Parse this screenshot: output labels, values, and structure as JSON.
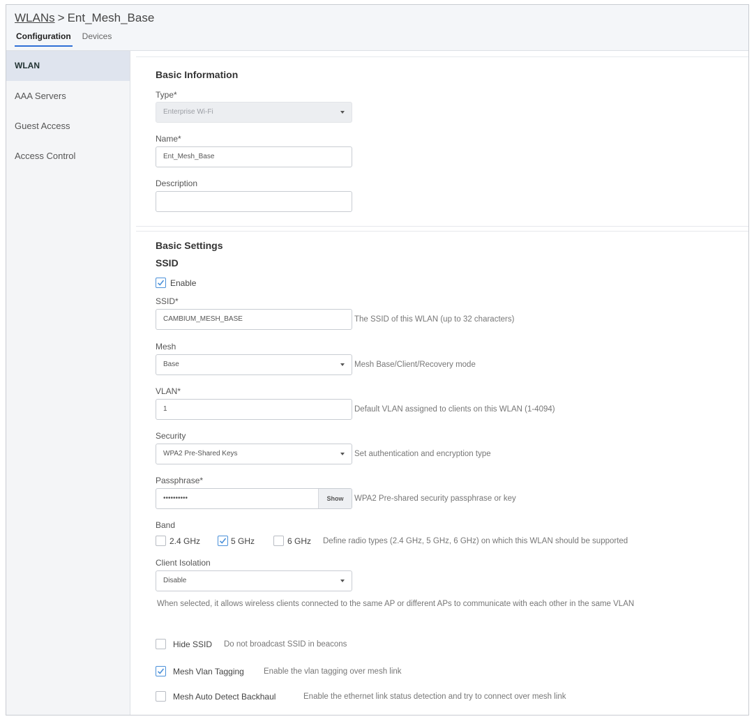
{
  "header": {
    "breadcrumb_root": "WLANs",
    "breadcrumb_sep": ">",
    "breadcrumb_current": "Ent_Mesh_Base",
    "tabs": [
      {
        "label": "Configuration",
        "active": true
      },
      {
        "label": "Devices",
        "active": false
      }
    ]
  },
  "sidebar": {
    "items": [
      {
        "label": "WLAN",
        "active": true
      },
      {
        "label": "AAA Servers",
        "active": false
      },
      {
        "label": "Guest Access",
        "active": false
      },
      {
        "label": "Access Control",
        "active": false
      }
    ]
  },
  "basic_info": {
    "title": "Basic Information",
    "type_label": "Type*",
    "type_value": "Enterprise Wi-Fi",
    "name_label": "Name*",
    "name_value": "Ent_Mesh_Base",
    "description_label": "Description",
    "description_value": ""
  },
  "basic_settings": {
    "title": "Basic Settings",
    "ssid_heading": "SSID",
    "enable_label": "Enable",
    "enable_checked": true,
    "ssid_label": "SSID*",
    "ssid_value": "CAMBIUM_MESH_BASE",
    "ssid_hint": "The SSID of this WLAN (up to 32 characters)",
    "mesh_label": "Mesh",
    "mesh_value": "Base",
    "mesh_hint": "Mesh Base/Client/Recovery mode",
    "vlan_label": "VLAN*",
    "vlan_value": "1",
    "vlan_hint": "Default VLAN assigned to clients on this WLAN (1-4094)",
    "security_label": "Security",
    "security_value": "WPA2 Pre-Shared Keys",
    "security_hint": "Set authentication and encryption type",
    "passphrase_label": "Passphrase*",
    "passphrase_value": "••••••••••",
    "passphrase_show": "Show",
    "passphrase_hint": "WPA2 Pre-shared security passphrase or key",
    "band_label": "Band",
    "band_24": "2.4 GHz",
    "band_24_checked": false,
    "band_5": "5 GHz",
    "band_5_checked": true,
    "band_6": "6 GHz",
    "band_6_checked": false,
    "band_hint": "Define radio types (2.4 GHz, 5 GHz, 6 GHz) on which this WLAN should be supported",
    "isolation_label": "Client Isolation",
    "isolation_value": "Disable",
    "isolation_desc": "When selected, it allows wireless clients connected to the same AP or different APs to communicate with each other in the same VLAN",
    "hide_ssid_label": "Hide SSID",
    "hide_ssid_hint": "Do not broadcast SSID in beacons",
    "hide_ssid_checked": false,
    "mesh_vlan_label": "Mesh Vlan Tagging",
    "mesh_vlan_hint": "Enable the vlan tagging over mesh link",
    "mesh_vlan_checked": true,
    "mesh_auto_label": "Mesh Auto Detect Backhaul",
    "mesh_auto_hint": "Enable the ethernet link status detection and try to connect over mesh link",
    "mesh_auto_checked": false
  },
  "colors": {
    "accent": "#2f6fd6",
    "check": "#4a90d9",
    "sidebar_active": "#dfe4ee"
  }
}
